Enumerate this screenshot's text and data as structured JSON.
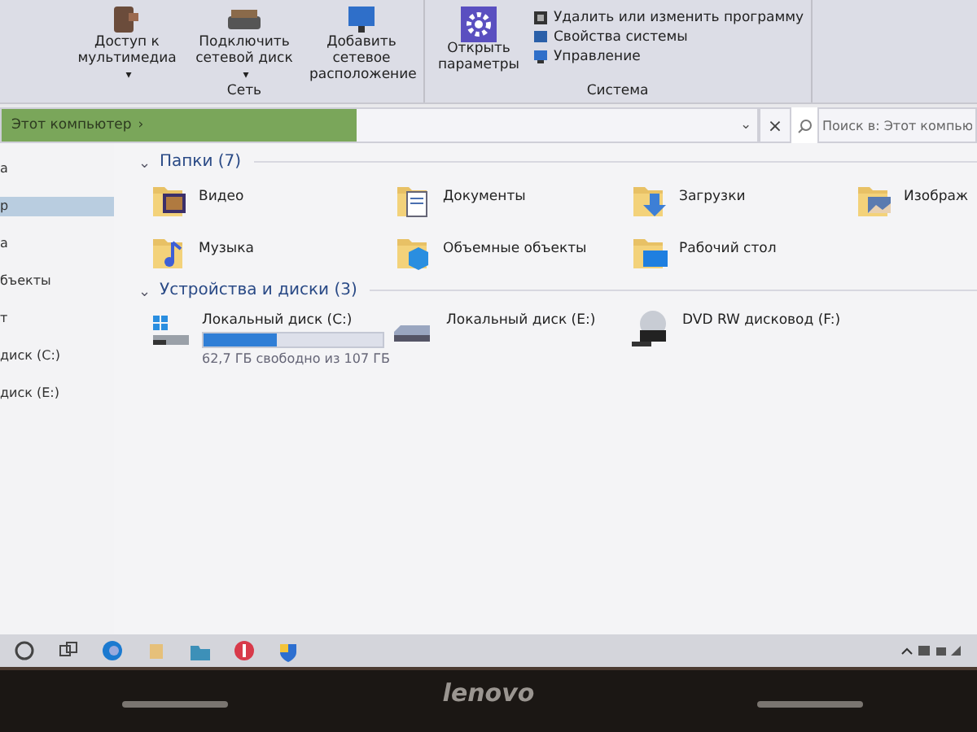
{
  "ribbon": {
    "groups": [
      {
        "label": "Сеть",
        "buttons": [
          {
            "label": "Доступ к мультимедиа",
            "dropdown": "▾",
            "kind": "media"
          },
          {
            "label": "Подключить сетевой диск",
            "dropdown": "▾",
            "kind": "drive"
          },
          {
            "label": "Добавить сетевое расположение",
            "kind": "monitor"
          }
        ]
      },
      {
        "label": "Система",
        "large_button": "Открыть параметры",
        "small_buttons": [
          "Удалить или изменить программу",
          "Свойства системы",
          "Управление"
        ]
      }
    ]
  },
  "address_bar": {
    "path": "Этот компьютер",
    "separator": "›",
    "level": 0.47,
    "dropdown": "⌄",
    "clear": "×",
    "search_placeholder": "Поиск в: Этот компью"
  },
  "nav_pane": {
    "items": [
      {
        "label": "а",
        "selected": false
      },
      {
        "label": "р",
        "selected": true
      },
      {
        "label": "а",
        "selected": false
      },
      {
        "label": "бъекты",
        "selected": false
      },
      {
        "label": "т",
        "selected": false
      },
      {
        "label": "диск (C:)",
        "selected": false
      },
      {
        "label": "диск (E:)",
        "selected": false
      }
    ]
  },
  "folders": {
    "title": "Папки (7)",
    "chevron": "⌄",
    "items": [
      {
        "label": "Видео",
        "kind": "video"
      },
      {
        "label": "Документы",
        "kind": "documents"
      },
      {
        "label": "Загрузки",
        "kind": "downloads"
      },
      {
        "label": "Изображ",
        "kind": "pictures"
      },
      {
        "label": "Музыка",
        "kind": "music"
      },
      {
        "label": "Объемные объекты",
        "kind": "objects3d"
      },
      {
        "label": "Рабочий стол",
        "kind": "desktop"
      }
    ]
  },
  "devices": {
    "title": "Устройства и диски (3)",
    "chevron": "⌄",
    "items": [
      {
        "label": "Локальный диск (C:)",
        "kind": "system",
        "level": 0.41,
        "info": "62,7 ГБ свободно из 107 ГБ"
      },
      {
        "label": "Локальный диск (E:)",
        "kind": "disk"
      },
      {
        "label": "DVD RW дисковод (F:)",
        "kind": "dvd"
      }
    ]
  },
  "taskbar": {
    "icons": [
      {
        "kind": "circle"
      },
      {
        "kind": "taskview"
      },
      {
        "kind": "browser"
      },
      {
        "kind": "files"
      },
      {
        "kind": "folder"
      },
      {
        "kind": "yandex"
      },
      {
        "kind": "shield"
      }
    ]
  },
  "bezel": {
    "logo": "lenovo"
  }
}
